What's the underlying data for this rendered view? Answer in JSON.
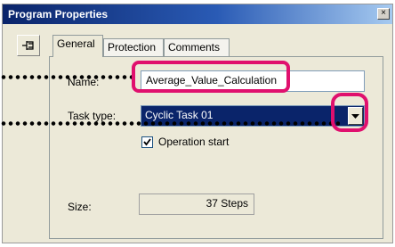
{
  "window": {
    "title": "Program Properties",
    "close_glyph": "×"
  },
  "tabs": [
    "General",
    "Protection",
    "Comments"
  ],
  "form": {
    "name_label": "Name:",
    "name_value": "Average_Value_Calculation",
    "task_type_label": "Task type:",
    "task_type_value": "Cyclic Task 01",
    "operation_start_label": "Operation start",
    "operation_start_checked": true,
    "size_label": "Size:",
    "size_value": "37 Steps"
  },
  "annotations": {
    "highlight_color": "#e0106e"
  },
  "icons": [
    "pin-icon",
    "close-icon",
    "dropdown-arrow-icon",
    "checkmark-icon"
  ]
}
